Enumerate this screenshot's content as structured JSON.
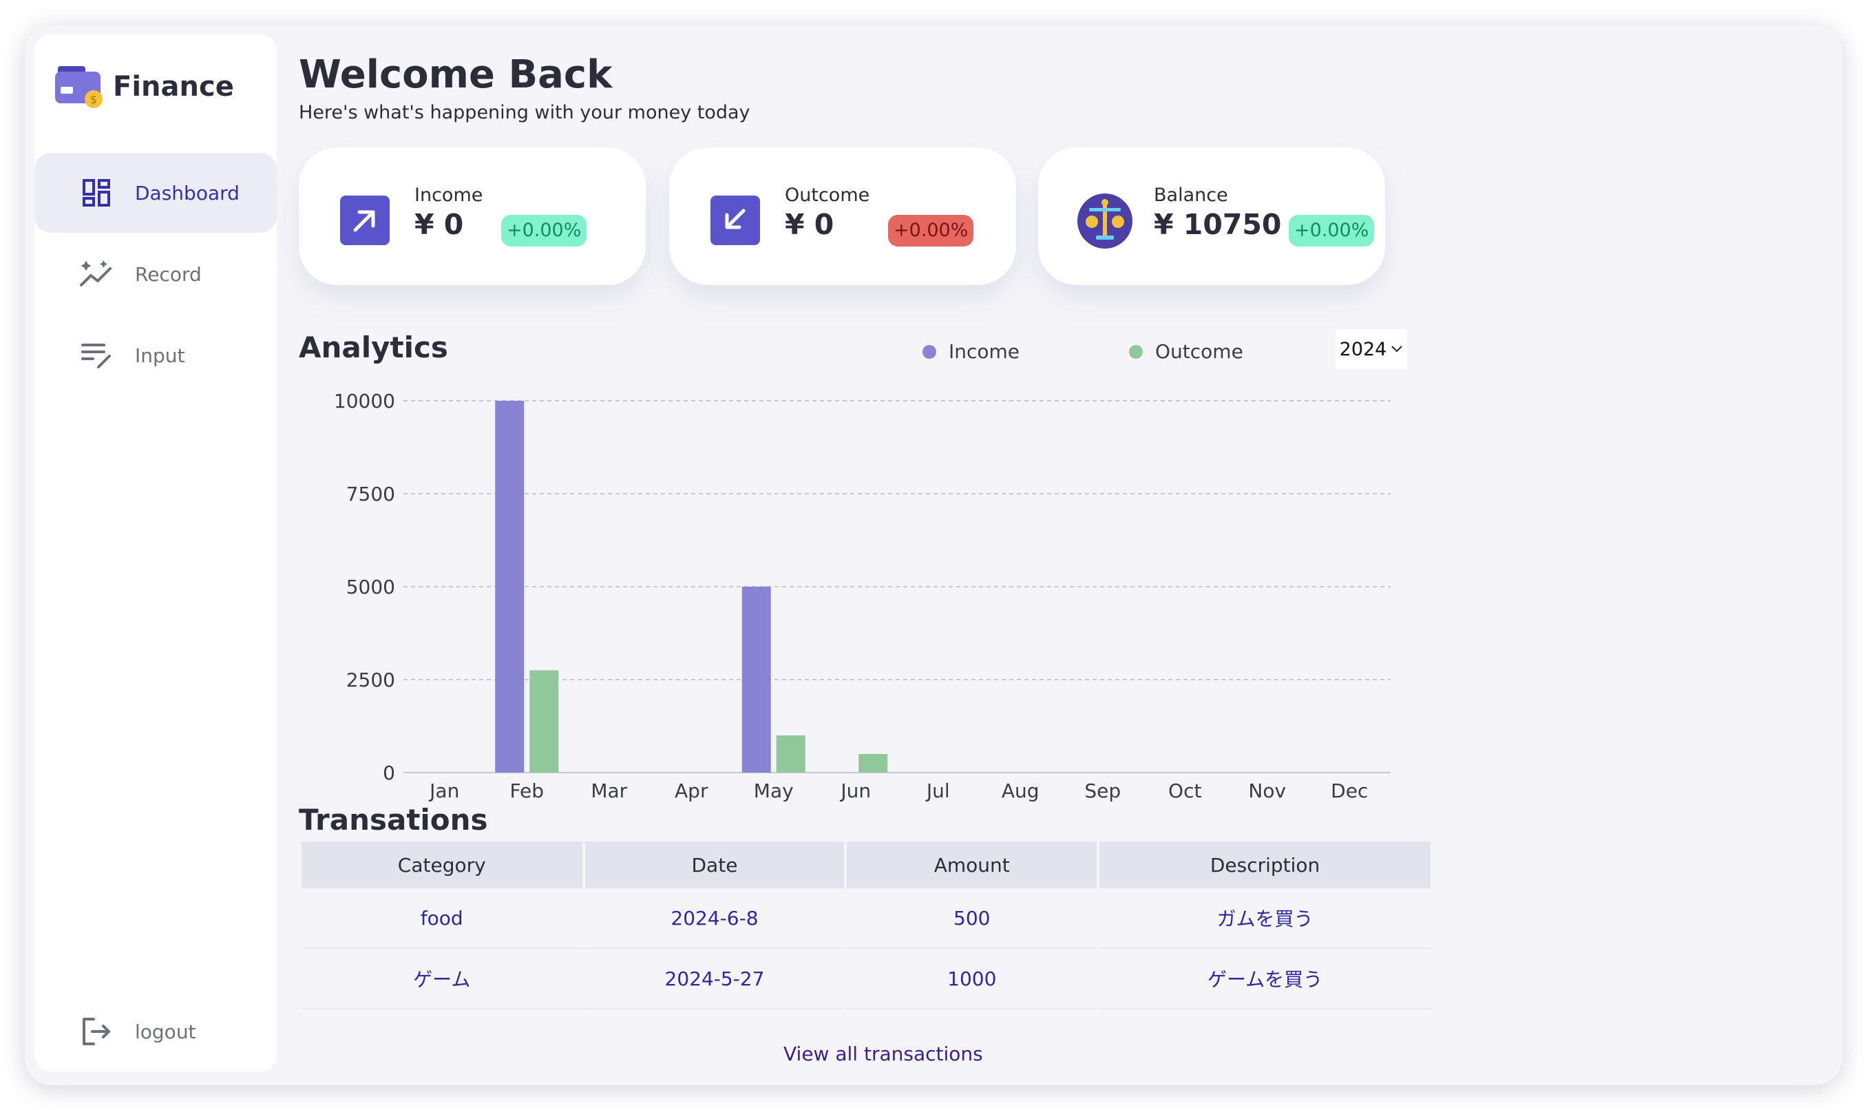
{
  "app": {
    "name": "Finance"
  },
  "sidebar": {
    "items": [
      {
        "label": "Dashboard",
        "icon": "dashboard-icon",
        "active": true
      },
      {
        "label": "Record",
        "icon": "chart-line-icon",
        "active": false
      },
      {
        "label": "Input",
        "icon": "edit-list-icon",
        "active": false
      }
    ],
    "logout": "logout"
  },
  "header": {
    "title": "Welcome Back",
    "subtitle": "Here's what's happening with your money today"
  },
  "cards": [
    {
      "label": "Income",
      "value": "¥ 0",
      "change": "+0.00%",
      "status": "positive",
      "icon": "arrow-up-right-icon"
    },
    {
      "label": "Outcome",
      "value": "¥ 0",
      "change": "+0.00%",
      "status": "negative",
      "icon": "arrow-down-left-icon"
    },
    {
      "label": "Balance",
      "value": "¥ 10750",
      "change": "+0.00%",
      "status": "positive",
      "icon": "scale-icon"
    }
  ],
  "analytics": {
    "title": "Analytics",
    "legend": [
      "Income",
      "Outcome"
    ],
    "year": "2024"
  },
  "colors": {
    "income": "#8884d3",
    "outcome": "#90c89a",
    "accent": "#3430a8"
  },
  "chart_data": {
    "type": "bar",
    "categories": [
      "Jan",
      "Feb",
      "Mar",
      "Apr",
      "May",
      "Jun",
      "Jul",
      "Aug",
      "Sep",
      "Oct",
      "Nov",
      "Dec"
    ],
    "series": [
      {
        "name": "Income",
        "values": [
          0,
          10000,
          0,
          0,
          5000,
          0,
          0,
          0,
          0,
          0,
          0,
          0
        ]
      },
      {
        "name": "Outcome",
        "values": [
          0,
          2750,
          0,
          0,
          1000,
          500,
          0,
          0,
          0,
          0,
          0,
          0
        ]
      }
    ],
    "yticks": [
      "0",
      "2500",
      "5000",
      "7500",
      "10000"
    ],
    "ylim": [
      0,
      10000
    ],
    "grid": true
  },
  "transactions": {
    "title": "Transations",
    "columns": [
      "Category",
      "Date",
      "Amount",
      "Description"
    ],
    "rows": [
      [
        "food",
        "2024-6-8",
        "500",
        "ガムを買う"
      ],
      [
        "ゲーム",
        "2024-5-27",
        "1000",
        "ゲームを買う"
      ]
    ],
    "view_all": "View all transactions"
  }
}
